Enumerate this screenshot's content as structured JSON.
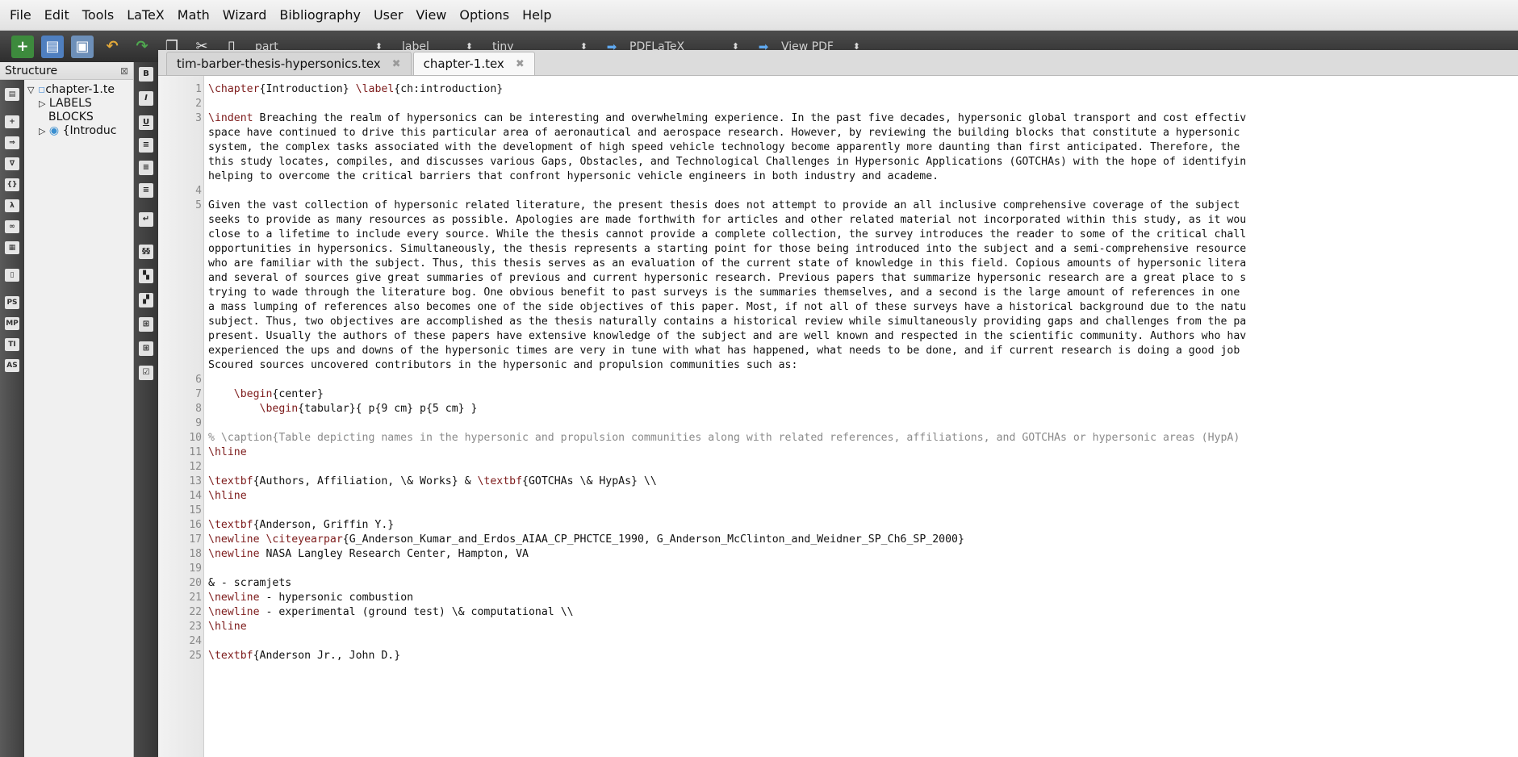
{
  "menu": [
    "File",
    "Edit",
    "Tools",
    "LaTeX",
    "Math",
    "Wizard",
    "Bibliography",
    "User",
    "View",
    "Options",
    "Help"
  ],
  "toolbar": {
    "combo_part": "part",
    "combo_label": "label",
    "combo_size": "tiny",
    "compiler": "PDFLaTeX",
    "viewer": "View PDF",
    "icons": [
      "new-file-icon",
      "open-folder-icon",
      "save-icon",
      "undo-icon",
      "redo-icon",
      "copy-icon",
      "cut-icon",
      "paste-icon"
    ]
  },
  "structure": {
    "title": "Structure",
    "items": [
      "chapter-1.te",
      "LABELS",
      "BLOCKS",
      "{Introduc"
    ]
  },
  "left_icons": [
    "document-icon",
    "+",
    "right-arrow-icon",
    "triangle-icon",
    "{}",
    "λ",
    "∞",
    "grid-icon",
    "frame-icon",
    "PS",
    "MP",
    "TI",
    "AS"
  ],
  "symbol_icons": [
    "B",
    "I",
    "U",
    "left-align-icon",
    "center-align-icon",
    "right-align-icon",
    "return-icon",
    "ss",
    "sq1",
    "sq2",
    "plus1",
    "plus2",
    "check-icon"
  ],
  "tabs": [
    {
      "label": "tim-barber-thesis-hypersonics.tex",
      "active": false
    },
    {
      "label": "chapter-1.tex",
      "active": true
    }
  ],
  "lines": [
    {
      "n": "1",
      "t": "\\chapter{Introduction} \\label{ch:introduction}"
    },
    {
      "n": "2",
      "t": ""
    },
    {
      "n": "3",
      "t": "\\indent Breaching the realm of hypersonics can be interesting and overwhelming experience. In the past five decades, hypersonic global transport and cost effectiv"
    },
    {
      "n": "",
      "t": "space have continued to drive this particular area of aeronautical and aerospace research. However, by reviewing the building blocks that constitute a hypersonic"
    },
    {
      "n": "",
      "t": "system, the complex tasks associated with the development of high speed vehicle technology become apparently more daunting than first anticipated. Therefore, the"
    },
    {
      "n": "",
      "t": "this study locates, compiles, and discusses various Gaps, Obstacles, and Technological Challenges in Hypersonic Applications (GOTCHAs) with the hope of identifyin"
    },
    {
      "n": "",
      "t": "helping to overcome the critical barriers that confront hypersonic vehicle engineers in both industry and academe."
    },
    {
      "n": "4",
      "t": ""
    },
    {
      "n": "5",
      "t": "Given the vast collection of hypersonic related literature, the present thesis does not attempt to provide an all inclusive comprehensive coverage of the subject"
    },
    {
      "n": "",
      "t": "seeks to provide as many resources as possible. Apologies are made forthwith for articles and other related material not incorporated within this study, as it wou"
    },
    {
      "n": "",
      "t": "close to a lifetime to include every source. While the thesis cannot provide a complete collection, the survey introduces the reader to some of the critical chall"
    },
    {
      "n": "",
      "t": "opportunities in hypersonics. Simultaneously, the thesis represents a starting point for those being introduced into the subject and a semi-comprehensive resource"
    },
    {
      "n": "",
      "t": "who are familiar with the subject. Thus, this thesis serves as an evaluation of the current state of knowledge in this field. Copious amounts of hypersonic litera"
    },
    {
      "n": "",
      "t": "and several of sources give great summaries of previous and current hypersonic research. Previous papers that summarize hypersonic research are a great place to s"
    },
    {
      "n": "",
      "t": "trying to wade through the literature bog. One obvious benefit to past surveys is the summaries themselves, and a second is the large amount of references in one"
    },
    {
      "n": "",
      "t": "a mass lumping of references also becomes one of the side objectives of this paper. Most, if not all of these surveys have a historical background due to the natu"
    },
    {
      "n": "",
      "t": "subject. Thus, two objectives are accomplished as the thesis naturally contains a historical review while simultaneously providing gaps and challenges from the pa"
    },
    {
      "n": "",
      "t": "present. Usually the authors of these papers have extensive knowledge of the subject and are well known and respected in the scientific community. Authors who hav"
    },
    {
      "n": "",
      "t": "experienced the ups and downs of the hypersonic times are very in tune with what has happened, what needs to be done, and if current research is doing a good job"
    },
    {
      "n": "",
      "t": "Scoured sources uncovered contributors in the hypersonic and propulsion communities such as:"
    },
    {
      "n": "6",
      "t": ""
    },
    {
      "n": "7",
      "t": "    \\begin{center}"
    },
    {
      "n": "8",
      "t": "        \\begin{tabular}{ p{9 cm} p{5 cm} }"
    },
    {
      "n": "9",
      "t": ""
    },
    {
      "n": "10",
      "t": "% \\caption{Table depicting names in the hypersonic and propulsion communities along with related references, affiliations, and GOTCHAs or hypersonic areas (HypA)"
    },
    {
      "n": "11",
      "t": "\\hline"
    },
    {
      "n": "12",
      "t": ""
    },
    {
      "n": "13",
      "t": "\\textbf{Authors, Affiliation, \\& Works} & \\textbf{GOTCHAs \\& HypAs} \\\\"
    },
    {
      "n": "14",
      "t": "\\hline"
    },
    {
      "n": "15",
      "t": ""
    },
    {
      "n": "16",
      "t": "\\textbf{Anderson, Griffin Y.}"
    },
    {
      "n": "17",
      "t": "\\newline \\citeyearpar{G_Anderson_Kumar_and_Erdos_AIAA_CP_PHCTCE_1990, G_Anderson_McClinton_and_Weidner_SP_Ch6_SP_2000}"
    },
    {
      "n": "18",
      "t": "\\newline NASA Langley Research Center, Hampton, VA"
    },
    {
      "n": "19",
      "t": ""
    },
    {
      "n": "20",
      "t": "& - scramjets"
    },
    {
      "n": "21",
      "t": "\\newline - hypersonic combustion"
    },
    {
      "n": "22",
      "t": "\\newline - experimental (ground test) \\& computational \\\\"
    },
    {
      "n": "23",
      "t": "\\hline"
    },
    {
      "n": "24",
      "t": ""
    },
    {
      "n": "25",
      "t": "\\textbf{Anderson Jr., John D.}"
    }
  ]
}
